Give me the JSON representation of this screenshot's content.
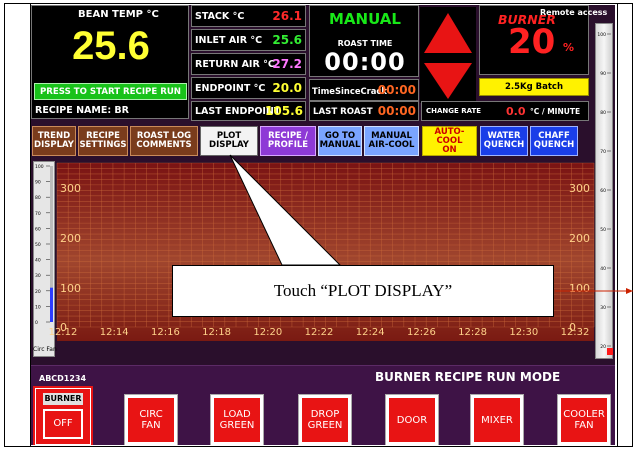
{
  "top": {
    "bean_temp": {
      "label": "BEAN TEMP °C",
      "value": "25.6",
      "start_button": "PRESS TO START RECIPE RUN",
      "recipe_name": "RECIPE NAME: BR"
    },
    "readouts": [
      {
        "label": "STACK °C",
        "value": "26.1",
        "color": "#ff2a2a"
      },
      {
        "label": "INLET AIR °C",
        "value": "25.6",
        "color": "#33ee33"
      },
      {
        "label": "RETURN AIR °C",
        "value": "27.2",
        "color": "#ff77ff"
      },
      {
        "label": "ENDPOINT °C",
        "value": "20.0",
        "color": "#ffff33"
      },
      {
        "label": "LAST ENDPOINT",
        "value": "105.6",
        "color": "#ffff33"
      }
    ],
    "mode": {
      "label": "MANUAL",
      "roast_time_label": "ROAST TIME",
      "roast_time": "00:00"
    },
    "time_since_crack": {
      "label": "TimeSinceCrack",
      "value": "00:00"
    },
    "last_roast": {
      "label": "LAST ROAST",
      "value": "00:00"
    },
    "burner": {
      "label": "BURNER",
      "value": "20",
      "unit": "%",
      "remote": "Remote access"
    },
    "batch": "2.5Kg Batch",
    "change_rate": {
      "label": "CHANGE RATE",
      "value": "0.0",
      "unit": "°C / MINUTE"
    }
  },
  "nav_buttons": [
    {
      "label": "TREND\nDISPLAY"
    },
    {
      "label": "RECIPE\nSETTINGS"
    },
    {
      "label": "ROAST LOG\nCOMMENTS"
    },
    {
      "label": "PLOT\nDISPLAY"
    },
    {
      "label": "RECIPE /\nPROFILE"
    },
    {
      "label": "GO TO\nMANUAL"
    },
    {
      "label": "MANUAL\nAIR-COOL"
    },
    {
      "label": "AUTO-COOL\nON"
    },
    {
      "label": "WATER\nQUENCH"
    },
    {
      "label": "CHAFF\nQUENCH"
    }
  ],
  "chart": {
    "y_ticks": [
      "300",
      "200",
      "100",
      "0"
    ],
    "x_ticks": [
      "12:12",
      "12:14",
      "12:16",
      "12:18",
      "12:20",
      "12:22",
      "12:24",
      "12:26",
      "12:28",
      "12:30",
      "12:32"
    ],
    "circ_fan_label": "Circ Fan",
    "left_gauge_ticks": [
      "100",
      "90",
      "80",
      "70",
      "60",
      "50",
      "40",
      "30",
      "20",
      "10",
      "0"
    ],
    "right_gauge_ticks": [
      "100",
      "90",
      "80",
      "70",
      "60",
      "50",
      "40",
      "30",
      "20"
    ],
    "circ_fan_level": 0.22,
    "burner_level": 0.2
  },
  "callout": {
    "text": "Touch “PLOT DISPLAY”"
  },
  "bottom": {
    "id": "ABCD1234",
    "mode_title": "BURNER RECIPE RUN MODE",
    "burner_box": {
      "label": "BURNER",
      "state": "OFF"
    },
    "buttons": [
      {
        "label": "CIRC\nFAN"
      },
      {
        "label": "LOAD\nGREEN"
      },
      {
        "label": "DROP\nGREEN"
      },
      {
        "label": "DOOR"
      },
      {
        "label": "MIXER"
      },
      {
        "label": "COOLER\nFAN"
      }
    ]
  }
}
